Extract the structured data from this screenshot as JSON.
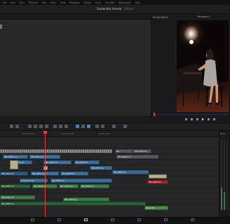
{
  "menu": {
    "items": [
      "File",
      "Edit",
      "Trim",
      "Timeline",
      "Clip",
      "Mark",
      "View",
      "Playback",
      "Fusion",
      "Color",
      "Fairlight",
      "Workspace",
      "Help"
    ]
  },
  "project": {
    "title": "Samantha Loredo",
    "status": "Edited"
  },
  "viewer": {
    "timecode": "00:00:06:41",
    "timeline_name": "Timeline 1"
  },
  "timeline": {
    "ruler_marks": [
      "00:00:00:00",
      "00:00:05:00",
      "00:00:10:00"
    ],
    "tracks": {
      "v3": [
        {
          "label": "IMG_2680.mov",
          "kind": "v"
        },
        {
          "label": "IMG_2681.mov",
          "kind": "v"
        },
        {
          "label": "Blur",
          "kind": "gray"
        },
        {
          "label": "IMG_2683.mov",
          "kind": "gray"
        }
      ],
      "v2": [
        {
          "label": "IMG_2682.mov",
          "kind": "v"
        },
        {
          "label": "IMG_2684.mov",
          "kind": "v"
        },
        {
          "label": "IMG_2685.mov",
          "kind": "v"
        },
        {
          "label": "IMG_2686.mov",
          "kind": "v"
        }
      ],
      "v1": [
        {
          "label": "IMG_2680.mov",
          "kind": "v"
        },
        {
          "label": "IMG_2683.mov",
          "kind": "v"
        },
        {
          "label": "IMG_2685.mov",
          "kind": "v"
        },
        {
          "label": "IMG_2687.mov",
          "kind": "v"
        },
        {
          "label": "IMG_2689.mov",
          "kind": "v"
        }
      ],
      "t1": [
        {
          "label": "Compound Clip",
          "kind": "v"
        },
        {
          "label": "IMG_2680.mov",
          "kind": "v"
        },
        {
          "label": "IMG_2690.mov",
          "kind": "red"
        }
      ],
      "a1": [
        {
          "label": "IMG_2680.mov",
          "kind": "a"
        },
        {
          "label": "IMG_2682.mov",
          "kind": "a"
        },
        {
          "label": "IMG_2683.mov",
          "kind": "a"
        },
        {
          "label": "IMG_2685.mov",
          "kind": "a"
        }
      ],
      "a2": [
        {
          "label": "IMG_2680.mov",
          "kind": "a"
        },
        {
          "label": "IMG_2686.mov",
          "kind": "a"
        },
        {
          "label": "IMG_2688.mov",
          "kind": "a"
        }
      ],
      "a3": [
        {
          "label": "Stereo Mix",
          "kind": "lgreen"
        }
      ]
    }
  },
  "mixer": {
    "label": "Mixer"
  },
  "pages": [
    "Media",
    "Cut",
    "Edit",
    "Fusion",
    "Color",
    "Fairlight",
    "Deliver"
  ],
  "active_page": "Edit",
  "colors": {
    "video_clip": "#3d6f9a",
    "audio_clip": "#3e7a4c",
    "playhead": "#e04040",
    "flagged_clip": "#9a2a2a"
  }
}
